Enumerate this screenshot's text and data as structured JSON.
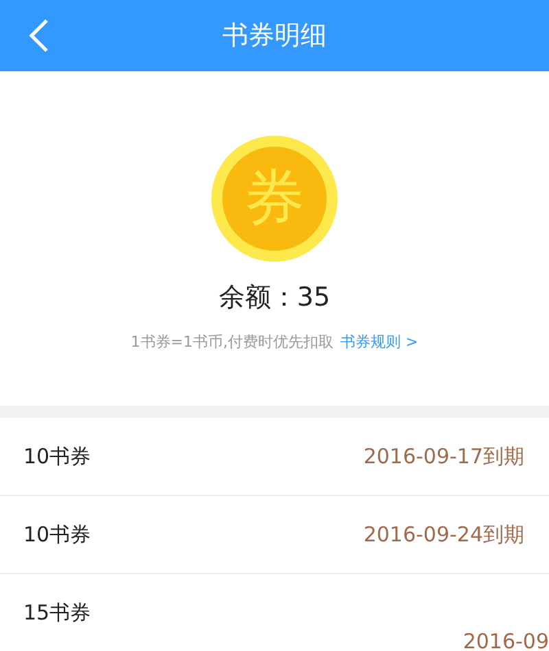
{
  "header": {
    "title": "书券明细"
  },
  "summary": {
    "coin_label": "券",
    "balance": "余额：35",
    "note": "1书券=1书币,付费时优先扣取",
    "rules_link": "书券规则 >"
  },
  "vouchers": [
    {
      "name": "10书券",
      "expiry": "2016-09-17到期",
      "offset": false
    },
    {
      "name": "10书券",
      "expiry": "2016-09-24到期",
      "offset": false
    },
    {
      "name": "15书券",
      "expiry": "2016-09",
      "offset": true
    }
  ]
}
